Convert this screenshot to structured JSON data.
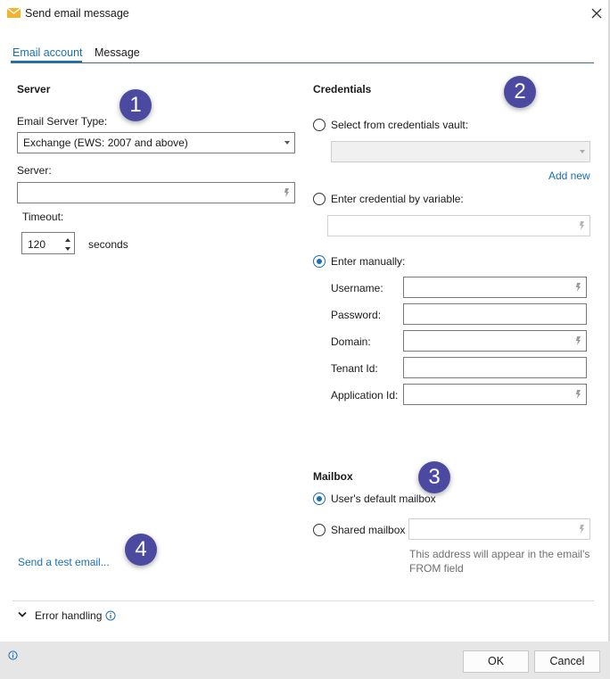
{
  "window": {
    "title": "Send email message"
  },
  "tabs": [
    {
      "label": "Email account"
    },
    {
      "label": "Message"
    }
  ],
  "server": {
    "heading": "Server",
    "type_label": "Email Server Type:",
    "type_value": "Exchange (EWS: 2007 and above)",
    "server_label": "Server:",
    "server_value": "",
    "timeout_label": "Timeout:",
    "timeout_value": "120",
    "timeout_unit": "seconds"
  },
  "credentials": {
    "heading": "Credentials",
    "vault_label": "Select from credentials vault:",
    "add_new": "Add new",
    "variable_label": "Enter credential by variable:",
    "manual_label": "Enter manually:",
    "username_label": "Username:",
    "password_label": "Password:",
    "domain_label": "Domain:",
    "tenant_label": "Tenant Id:",
    "appid_label": "Application Id:"
  },
  "mailbox": {
    "heading": "Mailbox",
    "default_label": "User's default mailbox",
    "shared_label": "Shared mailbox",
    "hint": "This address will appear in the email's FROM field"
  },
  "test_email_link": "Send a test email...",
  "error_handling": "Error handling",
  "buttons": {
    "ok": "OK",
    "cancel": "Cancel"
  },
  "badges": [
    "1",
    "2",
    "3",
    "4"
  ],
  "icons": {
    "app": "envelope-icon",
    "close": "close-icon",
    "variable": "variable-icon",
    "info": "info-icon",
    "chevron": "chevron-down-icon"
  },
  "colors": {
    "accent": "#1b6fb5",
    "badge": "#4b4aa0",
    "footer": "#e6e6e6"
  }
}
